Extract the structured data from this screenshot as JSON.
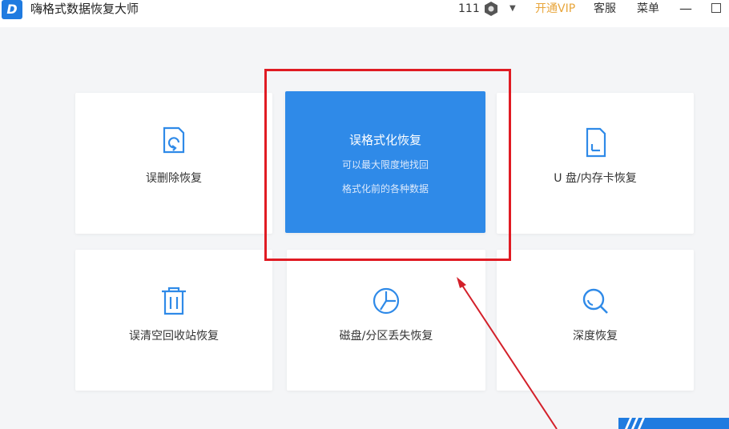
{
  "app": {
    "title": "嗨格式数据恢复大师",
    "logo_letter": "D",
    "user_id": "111",
    "vip_label": "开通VIP",
    "service_label": "客服",
    "menu_label": "菜单",
    "minimize_glyph": "—",
    "dropdown_glyph": "▼"
  },
  "cards": {
    "deleted": {
      "label": "误删除恢复",
      "icon": "file-restore-icon"
    },
    "format": {
      "title": "误格式化恢复",
      "desc_line1": "可以最大限度地找回",
      "desc_line2": "格式化前的各种数据"
    },
    "usb": {
      "label": "U 盘/内存卡恢复",
      "icon": "sd-card-icon"
    },
    "recycle": {
      "label": "误清空回收站恢复",
      "icon": "trash-icon"
    },
    "partition": {
      "label": "磁盘/分区丢失恢复",
      "icon": "pie-chart-icon"
    },
    "deep": {
      "label": "深度恢复",
      "icon": "magnifier-icon"
    }
  },
  "colors": {
    "accent": "#2f8ae8",
    "highlight": "#e01b23",
    "vip": "#e8a53a"
  }
}
